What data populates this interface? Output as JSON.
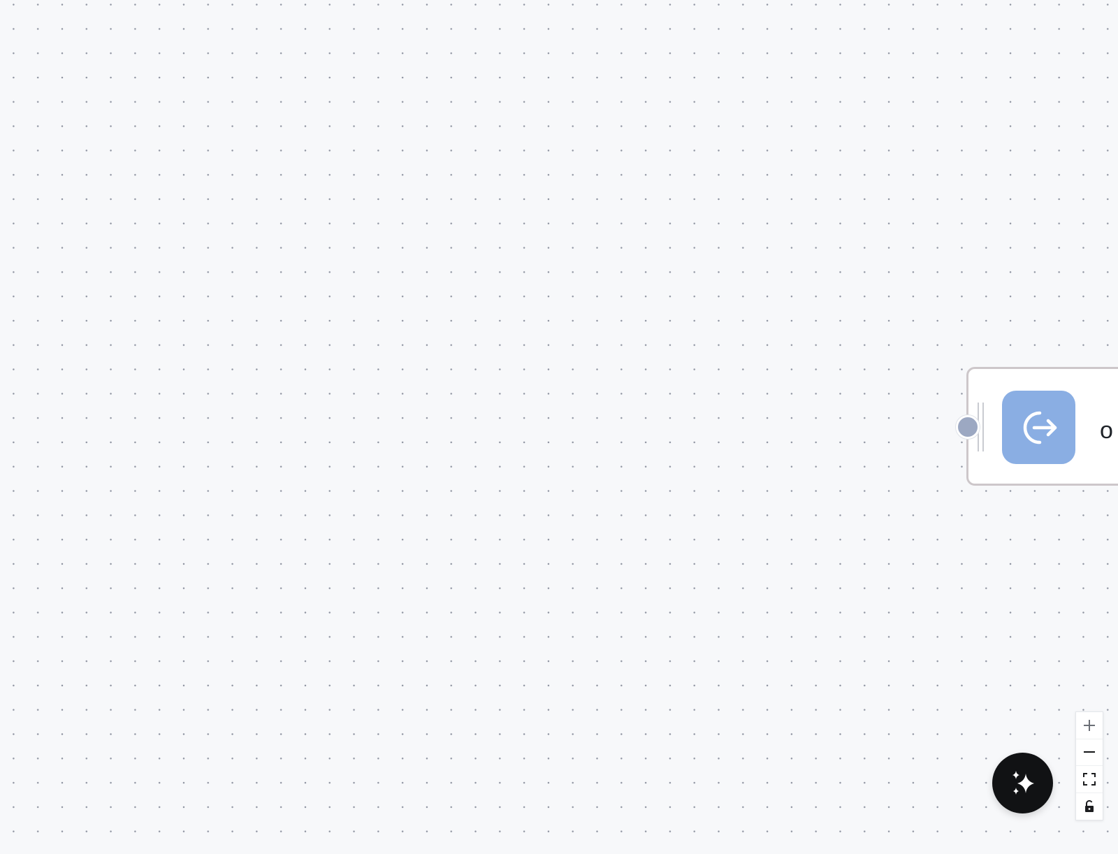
{
  "node": {
    "label": "o",
    "icon": "exit-arrow-icon",
    "icon_color": "#8aaee3",
    "border_color": "#cdc7ca"
  },
  "ai_button": {
    "icon": "sparkles-icon",
    "color": "#111214"
  },
  "controls": [
    {
      "icon": "plus-icon"
    },
    {
      "icon": "minus-icon"
    },
    {
      "icon": "fit-view-icon"
    },
    {
      "icon": "unlock-icon"
    }
  ],
  "canvas": {
    "background": "#f7f8fa",
    "dot_color": "#8e93a0"
  }
}
